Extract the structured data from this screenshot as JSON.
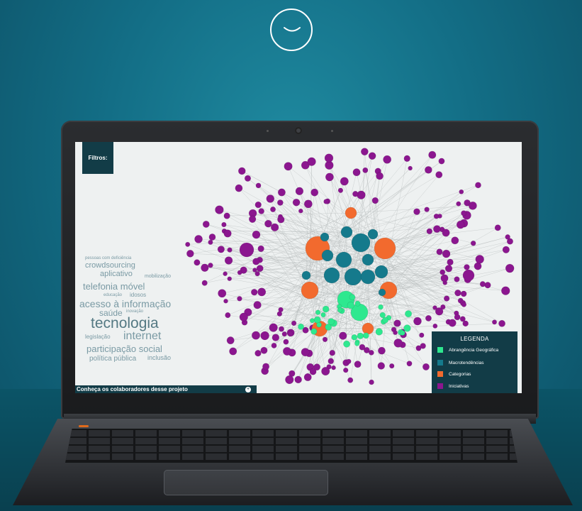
{
  "scroll_icon": "chevron-down-icon",
  "screen": {
    "filter_label": "Filtros:",
    "footer_text": "Conheça os colaboradores desse projeto",
    "footer_icon": "plus-icon",
    "word_cloud": [
      "pessoas com deficiência",
      "crowdsourcing",
      "aplicativo",
      "mobilização",
      "telefonia móvel",
      "educação",
      "idosos",
      "acesso à informação",
      "saúde",
      "inovação",
      "tecnologia",
      "legislação",
      "internet",
      "participação social",
      "política pública",
      "inclusão"
    ],
    "legend": {
      "title": "LEGENDA",
      "items": [
        {
          "label": "Abrangência Geográfica",
          "color": "#2ee88f"
        },
        {
          "label": "Macrotendências",
          "color": "#157a8c"
        },
        {
          "label": "Categorias",
          "color": "#f26a2e"
        },
        {
          "label": "Iniciativas",
          "color": "#8b168f"
        }
      ]
    },
    "colors": {
      "edge": "#b8bcbc",
      "initiative": "#8b168f",
      "macro": "#157a8c",
      "category": "#f26a2e",
      "geo": "#2ee88f"
    }
  }
}
